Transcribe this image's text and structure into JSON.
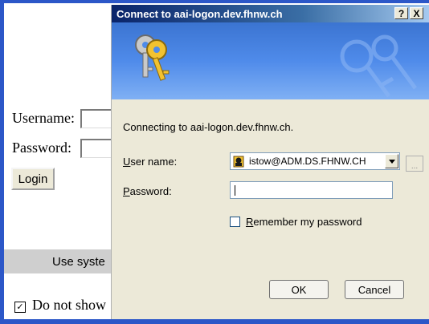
{
  "background_page": {
    "username_label": "Username:",
    "password_label": "Password:",
    "login_button": "Login",
    "bar_text": "Use syste",
    "checkbox_label": "Do not show",
    "checkbox_mark": "☑"
  },
  "dialog": {
    "title": "Connect to aai-logon.dev.fhnw.ch",
    "help_button": "?",
    "close_button": "X",
    "connecting_text": "Connecting to aai-logon.dev.fhnw.ch.",
    "user_name_label": "User name:",
    "user_name_value": "istow@ADM.DS.FHNW.CH",
    "ellipsis_button": "...",
    "password_label": "Password:",
    "password_value": "",
    "remember_label": "Remember my password",
    "remember_checked": false,
    "ok_button": "OK",
    "cancel_button": "Cancel"
  },
  "colors": {
    "title_start": "#0a246a",
    "title_end": "#a6caf0",
    "dialog_face": "#ece9d8",
    "page_frame": "#2c57c8"
  }
}
